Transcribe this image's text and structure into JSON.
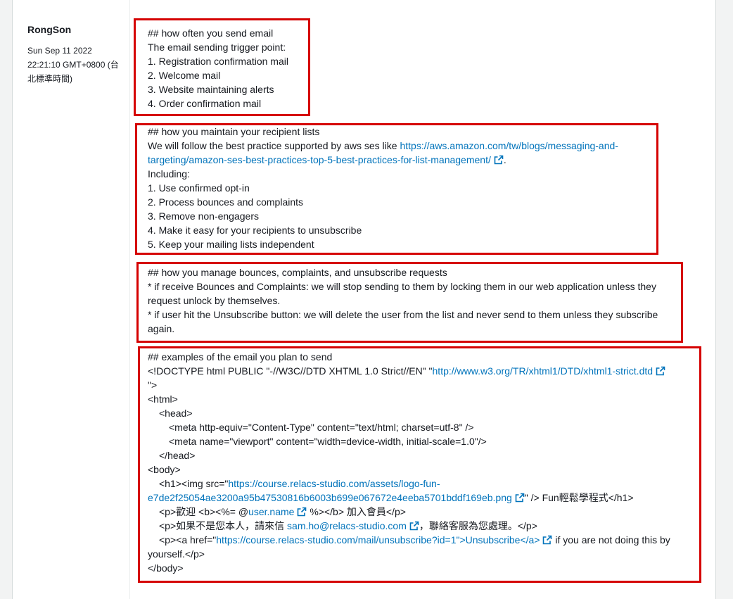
{
  "author": "RongSon",
  "date": [
    "Sun Sep 11 2022",
    "22:21:10 GMT+0800 (台",
    "北標準時間)"
  ],
  "section1": {
    "heading": "## how often you send email",
    "intro": "The email sending trigger point:",
    "items": [
      "1. Registration confirmation mail",
      "2. Welcome mail",
      "3. Website maintaining alerts",
      "4. Order confirmation mail"
    ]
  },
  "section2": {
    "heading": "## how you maintain your recipient lists",
    "intro": "We will follow the best practice supported by aws ses like ",
    "link_line1": "https://aws.amazon.com/tw/blogs/messaging-and-",
    "link_line2": "targeting/amazon-ses-best-practices-top-5-best-practices-for-list-management/",
    "after_link": ".",
    "including": "Including:",
    "items": [
      "1. Use confirmed opt-in",
      "2. Process bounces and complaints",
      "3. Remove non-engagers",
      "4. Make it easy for your recipients to unsubscribe",
      "5. Keep your mailing lists independent"
    ]
  },
  "section3": {
    "heading": "## how you manage bounces, complaints, and unsubscribe requests",
    "lines": [
      "* if receive Bounces and Complaints: we will stop sending to them by locking them in our web application unless they",
      "request unlock by themselves.",
      "* if user hit the Unsubscribe button: we will delete the user from the list and never send to them unless they subscribe",
      "again."
    ]
  },
  "section4": {
    "heading": "## examples of the email you plan to send",
    "doctype_pre": "<!DOCTYPE html PUBLIC \"-//W3C//DTD XHTML 1.0 Strict//EN\" \"",
    "doctype_link": "http://www.w3.org/TR/xhtml1/DTD/xhtml1-strict.dtd",
    "doctype_end": "\">",
    "html_open": "<html>",
    "head_open": "<head>",
    "meta1": "<meta http-equiv=\"Content-Type\" content=\"text/html; charset=utf-8\" />",
    "meta2": "<meta name=\"viewport\" content=\"width=device-width, initial-scale=1.0\"/>",
    "head_close": "</head>",
    "body_open": "<body>",
    "h1_pre": "<h1><img src=\"",
    "h1_link1": "https://course.relacs-studio.com/assets/logo-fun-",
    "h1_link2": "e7de2f25054ae3200a95b47530816b6003b699e067672e4eeba5701bddf169eb.png",
    "h1_post": "\" /> Fun輕鬆學程式</h1>",
    "p1_pre": "<p>歡迎 <b><%= @",
    "p1_link": "user.name",
    "p1_post": " %></b> 加入會員</p>",
    "p2_pre": "<p>如果不是您本人，請來信 ",
    "p2_link": "sam.ho@relacs-studio.com",
    "p2_post": "，聯絡客服為您處理。</p>",
    "p3_pre": "<p><a href=\"",
    "p3_link": "https://course.relacs-studio.com/mail/unsubscribe?id=1\">Unsubscribe</a>",
    "p3_post": " if you are not doing this by",
    "p3_line2": "yourself.</p>",
    "body_close": "</body>"
  },
  "colors": {
    "link": "#0073bb",
    "highlight_border": "#d50000"
  }
}
